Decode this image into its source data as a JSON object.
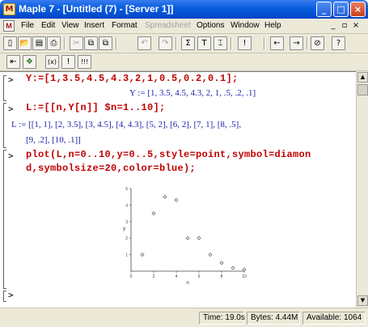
{
  "window": {
    "title": "Maple 7 - [Untitled (7) - [Server 1]]",
    "app_icon_glyph": "M",
    "minimize_glyph": "_",
    "maximize_glyph": "□",
    "close_glyph": "×"
  },
  "menu": {
    "doc_icon_glyph": "M",
    "items": [
      {
        "label": "File"
      },
      {
        "label": "Edit"
      },
      {
        "label": "View"
      },
      {
        "label": "Insert"
      },
      {
        "label": "Format"
      },
      {
        "label": "Spreadsheet"
      },
      {
        "label": "Options"
      },
      {
        "label": "Window"
      },
      {
        "label": "Help"
      }
    ],
    "mdi_min": "_",
    "mdi_restore": "▫",
    "mdi_close": "×"
  },
  "toolbar1": {
    "icons": [
      "new-icon",
      "open-icon",
      "save-icon",
      "print-icon",
      "cut-icon",
      "copy-icon",
      "paste-icon",
      "undo-icon",
      "redo-icon",
      "sum-icon",
      "text-icon",
      "paragraph-icon",
      "execute-icon",
      "back-icon",
      "forward-icon",
      "stop-icon",
      "help-icon"
    ],
    "glyphs": [
      "▯",
      "📂",
      "▤",
      "⎙",
      "✂",
      "⧉",
      "⧉",
      "↶",
      "↷",
      "Σ",
      "T",
      "⌶",
      "!",
      "←",
      "→",
      "⊘",
      "?"
    ]
  },
  "toolbar2": {
    "glyphs": [
      "⇤",
      "❖",
      "(x)",
      "!",
      "!!!"
    ]
  },
  "worksheet": {
    "prompt": ">",
    "input1": "Y:=[1,3.5,4.5,4.3,2,1,0.5,0.2,0.1];",
    "output1": "Y := [1, 3.5, 4.5, 4.3, 2, 1, .5, .2, .1]",
    "input2": "L:=[[n,Y[n]] $n=1..10];",
    "output2_a": "L := [[1, 1], [2, 3.5], [3, 4.5], [4, 4.3], [5, 2], [6, 2], [7, 1], [8, .5],",
    "output2_b": "[9, .2], [10, .1]]",
    "input3_a": "plot(L,n=0..10,y=0..5,style=point,symbol=diamon",
    "input3_b": "d,symbolsize=20,color=blue);",
    "empty_prompt": ">"
  },
  "chart_data": {
    "type": "scatter",
    "x": [
      1,
      2,
      3,
      4,
      5,
      6,
      7,
      8,
      9,
      10
    ],
    "y": [
      1,
      3.5,
      4.5,
      4.3,
      2,
      2,
      1,
      0.5,
      0.2,
      0.1
    ],
    "xlim": [
      0,
      10
    ],
    "ylim": [
      0,
      5
    ],
    "xticks": [
      "0",
      "2",
      "4",
      "6",
      "8",
      "10"
    ],
    "yticks": [
      "1",
      "2",
      "3",
      "4",
      "5"
    ],
    "xlabel": "n",
    "ylabel": "y",
    "title": "",
    "marker": "diamond",
    "color": "#555555",
    "grid": false
  },
  "status": {
    "time": "Time: 19.0s",
    "bytes": "Bytes: 4.44M",
    "available": "Available: 1064"
  }
}
